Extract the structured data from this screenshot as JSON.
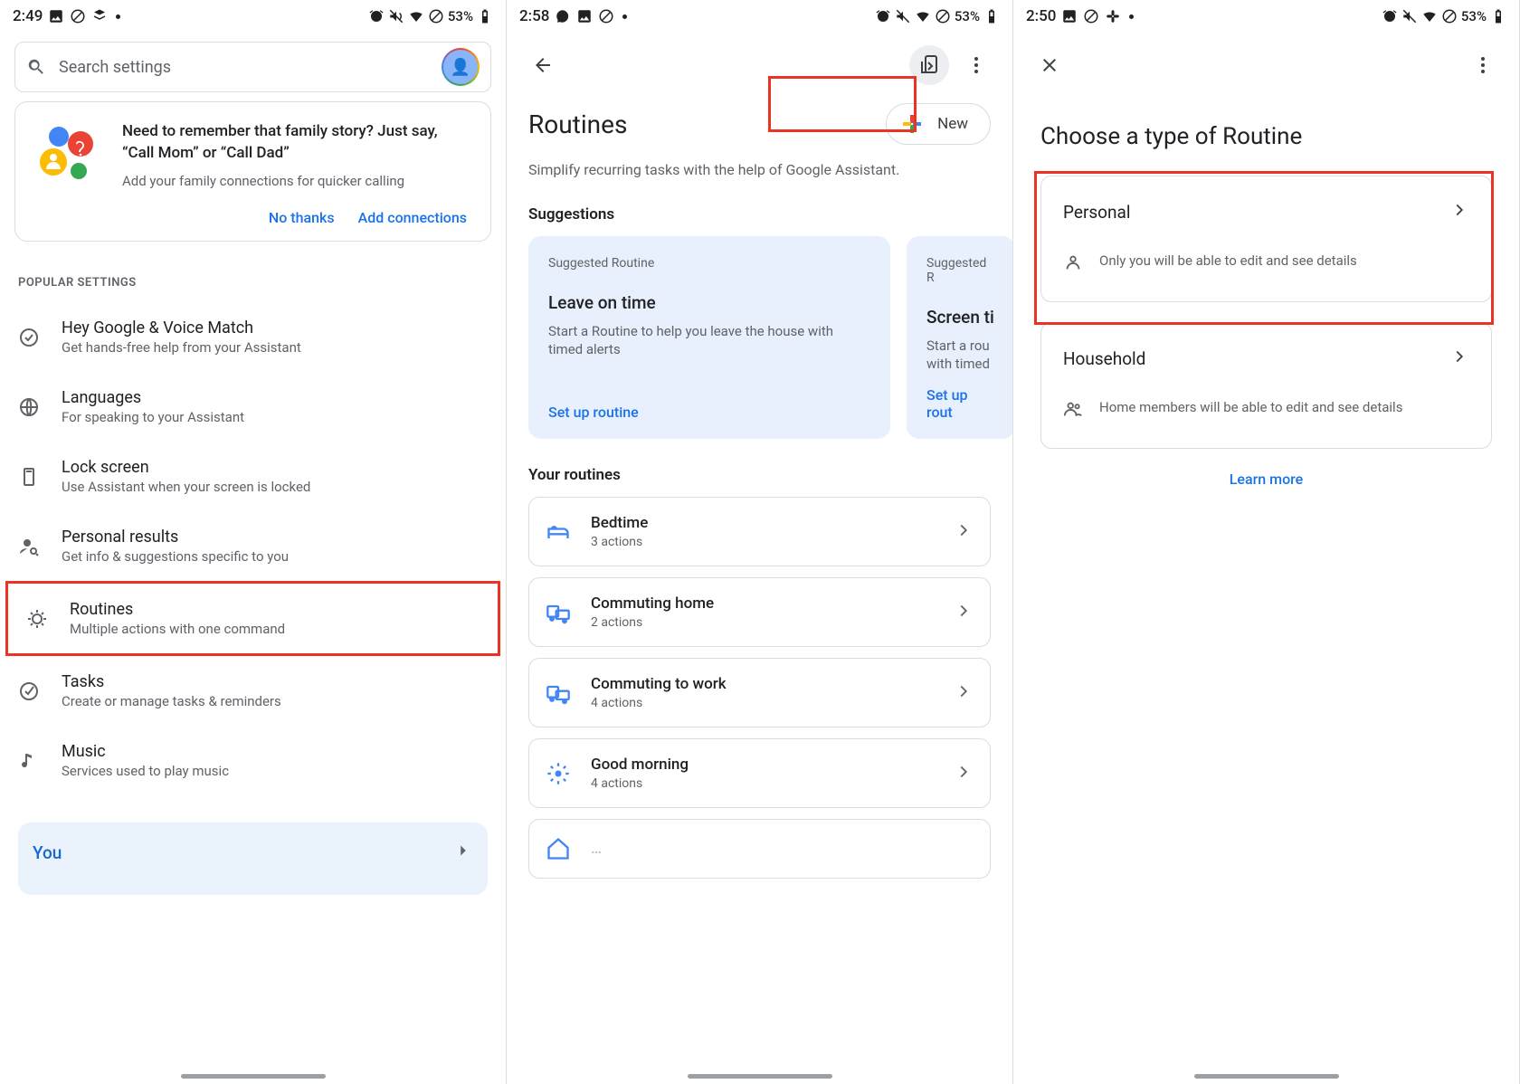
{
  "panel1": {
    "status_time": "2:49",
    "battery": "53%",
    "search_placeholder": "Search settings",
    "promo_title": "Need to remember that family story? Just say, “Call Mom” or “Call Dad”",
    "promo_sub": "Add your family connections for quicker calling",
    "promo_no": "No thanks",
    "promo_yes": "Add connections",
    "section": "POPULAR SETTINGS",
    "settings": [
      {
        "title": "Hey Google & Voice Match",
        "sub": "Get hands-free help from your Assistant"
      },
      {
        "title": "Languages",
        "sub": "For speaking to your Assistant"
      },
      {
        "title": "Lock screen",
        "sub": "Use Assistant when your screen is locked"
      },
      {
        "title": "Personal results",
        "sub": "Get info & suggestions specific to you"
      },
      {
        "title": "Routines",
        "sub": "Multiple actions with one command"
      },
      {
        "title": "Tasks",
        "sub": "Create or manage tasks & reminders"
      },
      {
        "title": "Music",
        "sub": "Services used to play music"
      }
    ],
    "you": "You"
  },
  "panel2": {
    "status_time": "2:58",
    "battery": "53%",
    "title": "Routines",
    "new_label": "New",
    "subtitle": "Simplify recurring tasks with the help of Google Assistant.",
    "suggestions_label": "Suggestions",
    "suggestions": [
      {
        "badge": "Suggested Routine",
        "title": "Leave on time",
        "desc": "Start a Routine to help you leave the house with timed alerts",
        "cta": "Set up routine"
      },
      {
        "badge": "Suggested R",
        "title": "Screen ti",
        "desc": "Start a rou\nwith timed",
        "cta": "Set up rout"
      }
    ],
    "your_label": "Your routines",
    "routines": [
      {
        "title": "Bedtime",
        "sub": "3 actions",
        "icon": "bed"
      },
      {
        "title": "Commuting home",
        "sub": "2 actions",
        "icon": "commute"
      },
      {
        "title": "Commuting to work",
        "sub": "4 actions",
        "icon": "commute"
      },
      {
        "title": "Good morning",
        "sub": "4 actions",
        "icon": "sun"
      }
    ]
  },
  "panel3": {
    "status_time": "2:50",
    "battery": "53%",
    "title": "Choose a type of Routine",
    "types": [
      {
        "title": "Personal",
        "desc": "Only you will be able to edit and see details"
      },
      {
        "title": "Household",
        "desc": "Home members will be able to edit and see details"
      }
    ],
    "learn": "Learn more"
  }
}
